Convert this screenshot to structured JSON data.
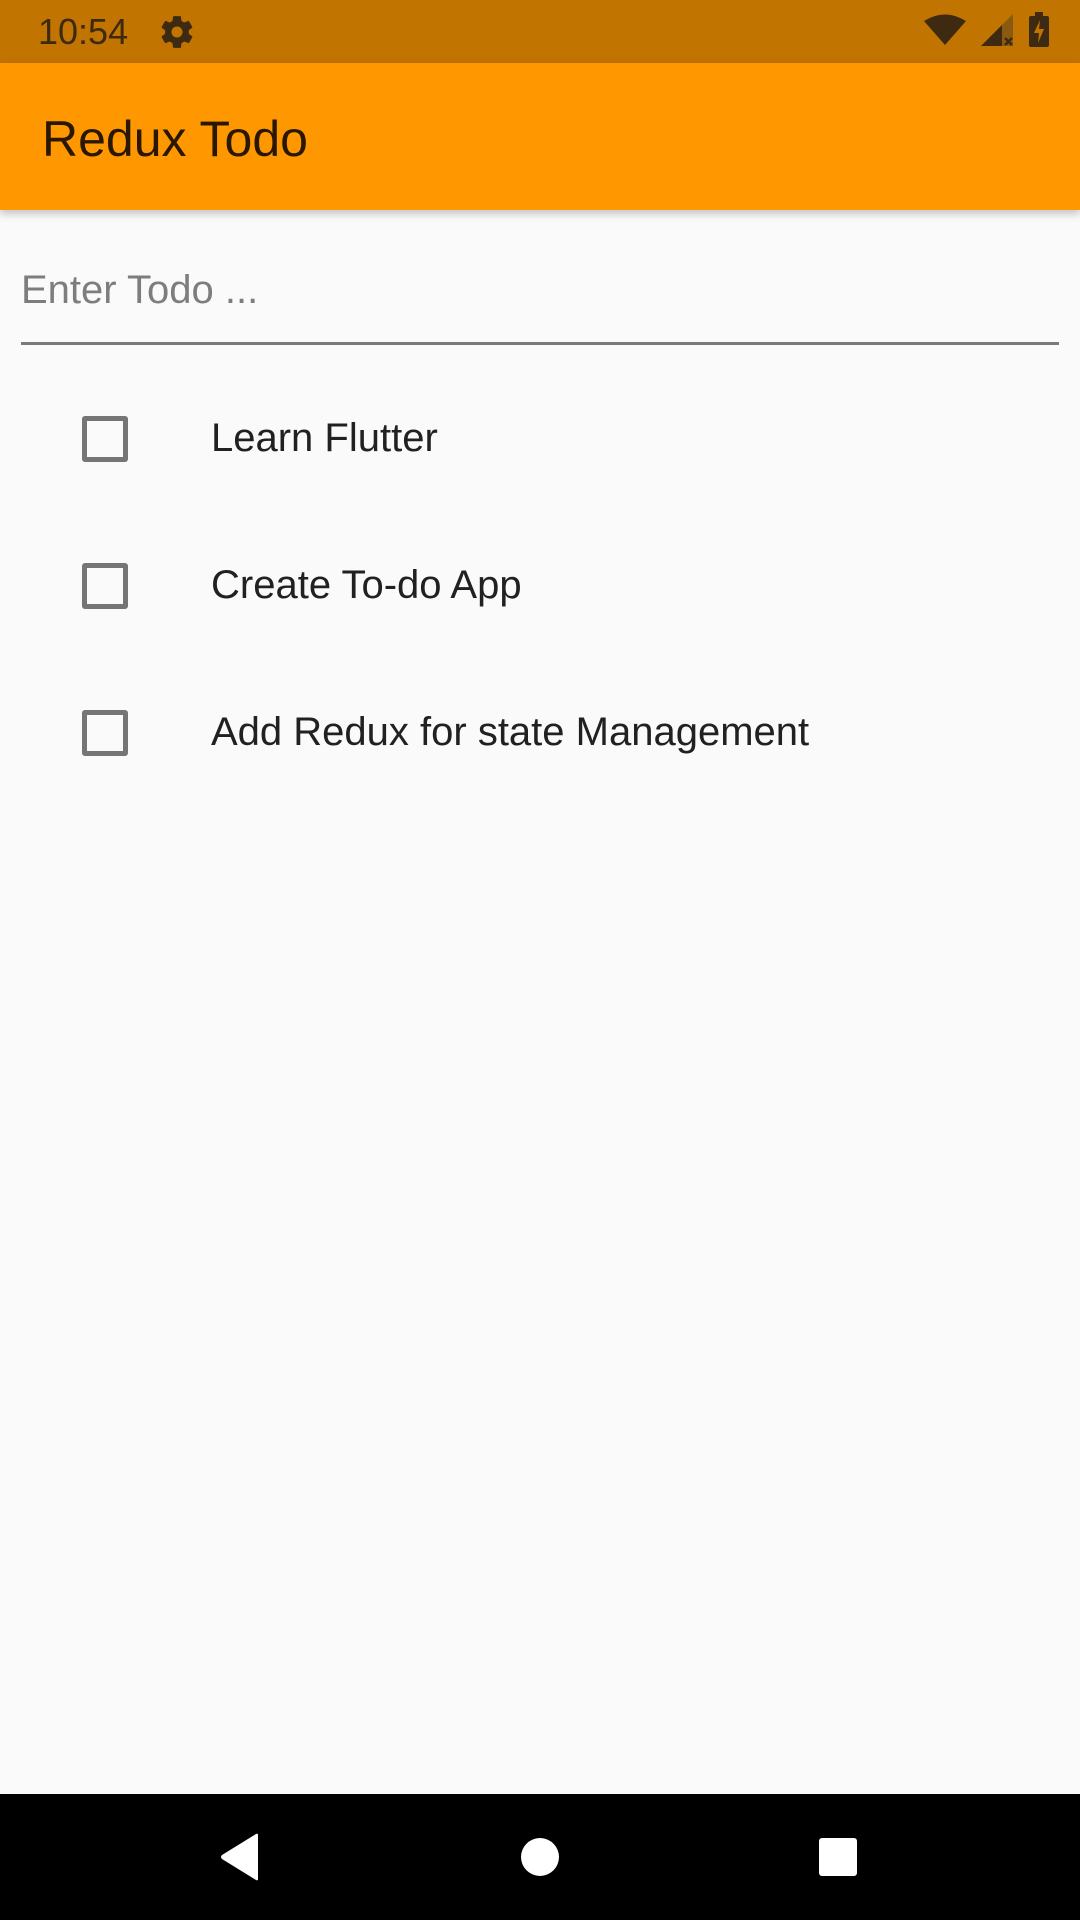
{
  "status_bar": {
    "time": "10:54",
    "icons": [
      "gear-icon",
      "wifi-icon",
      "cell-signal-icon",
      "battery-icon"
    ]
  },
  "app_bar": {
    "title": "Redux Todo"
  },
  "todo_input": {
    "placeholder": "Enter Todo ...",
    "value": ""
  },
  "todos": [
    {
      "label": "Learn Flutter",
      "checked": false
    },
    {
      "label": "Create To-do App",
      "checked": false
    },
    {
      "label": "Add Redux for state Management",
      "checked": false
    }
  ],
  "nav_bar": {
    "icons": [
      "back-icon",
      "home-icon",
      "recents-icon"
    ]
  },
  "colors": {
    "status_bar": "#c17400",
    "app_bar": "#ff9800",
    "background": "#fafafa",
    "nav_bar": "#000000"
  }
}
